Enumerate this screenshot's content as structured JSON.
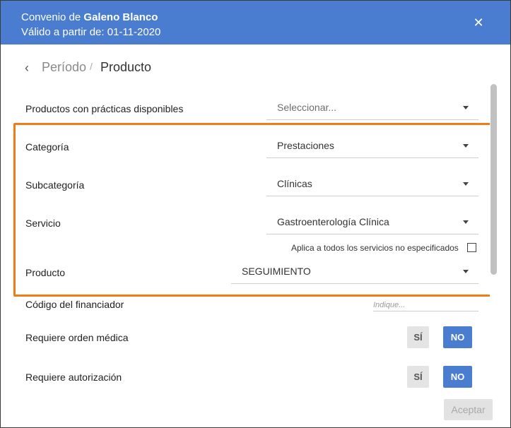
{
  "header": {
    "agreement_prefix": "Convenio de ",
    "agreement_name": "Galeno Blanco",
    "valid_from": "Válido a partir de: 01-11-2020",
    "close_symbol": "✕"
  },
  "breadcrumb": {
    "back_symbol": "‹",
    "items": [
      "Período",
      "Producto"
    ],
    "separator": "/"
  },
  "form": {
    "products_available": {
      "label": "Productos con prácticas disponibles",
      "placeholder": "Seleccionar..."
    },
    "category": {
      "label": "Categoría",
      "value": "Prestaciones"
    },
    "subcategory": {
      "label": "Subcategoría",
      "value": "Clínicas"
    },
    "service": {
      "label": "Servicio",
      "value": "Gastroenterología Clínica"
    },
    "apply_all": {
      "label": "Aplica a todos los servicios no especificados",
      "checked": false
    },
    "product": {
      "label": "Producto",
      "value": "SEGUIMIENTO"
    },
    "financier_code": {
      "label": "Código del financiador",
      "placeholder": "Indique..."
    },
    "requires_medical_order": {
      "label": "Requiere orden médica",
      "yes": "SÍ",
      "no": "NO",
      "selected": "NO"
    },
    "requires_authorization": {
      "label": "Requiere autorización",
      "yes": "SÍ",
      "no": "NO",
      "selected": "NO"
    }
  },
  "footer": {
    "accept_label": "Aceptar"
  },
  "colors": {
    "header": "#4a7ccf",
    "highlight": "#f07d14",
    "selected_button": "#4a7ccf"
  }
}
